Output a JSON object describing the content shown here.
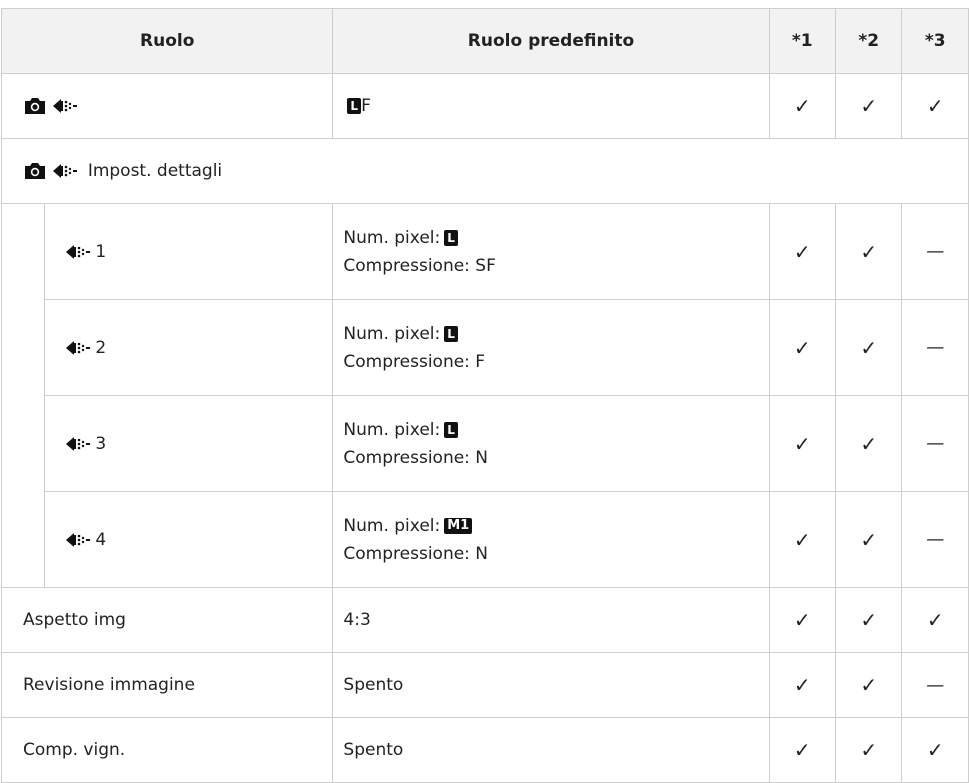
{
  "header": {
    "role": "Ruolo",
    "default_role": "Ruolo predefinito",
    "c1": "*1",
    "c2": "*2",
    "c3": "*3"
  },
  "row_quality": {
    "value_suffix": "F",
    "value_badge": "L",
    "c1": "✓",
    "c2": "✓",
    "c3": "✓"
  },
  "row_section": {
    "label": "Impost. dettagli"
  },
  "sub_rows": [
    {
      "num": "1",
      "px_label": "Num. pixel:",
      "px_badge": "L",
      "comp": "Compressione: SF",
      "c1": "✓",
      "c2": "✓",
      "c3": "—"
    },
    {
      "num": "2",
      "px_label": "Num. pixel:",
      "px_badge": "L",
      "comp": "Compressione: F",
      "c1": "✓",
      "c2": "✓",
      "c3": "—"
    },
    {
      "num": "3",
      "px_label": "Num. pixel:",
      "px_badge": "L",
      "comp": "Compressione: N",
      "c1": "✓",
      "c2": "✓",
      "c3": "—"
    },
    {
      "num": "4",
      "px_label": "Num. pixel:",
      "px_badge": "M1",
      "comp": "Compressione: N",
      "c1": "✓",
      "c2": "✓",
      "c3": "—"
    }
  ],
  "rows": [
    {
      "label": "Aspetto img",
      "value": "4:3",
      "c1": "✓",
      "c2": "✓",
      "c3": "✓"
    },
    {
      "label": "Revisione immagine",
      "value": "Spento",
      "c1": "✓",
      "c2": "✓",
      "c3": "—"
    },
    {
      "label": "Comp. vign.",
      "value": "Spento",
      "c1": "✓",
      "c2": "✓",
      "c3": "✓"
    }
  ],
  "icons": {
    "camera": "camera-icon",
    "quality": "image-quality-icon"
  }
}
